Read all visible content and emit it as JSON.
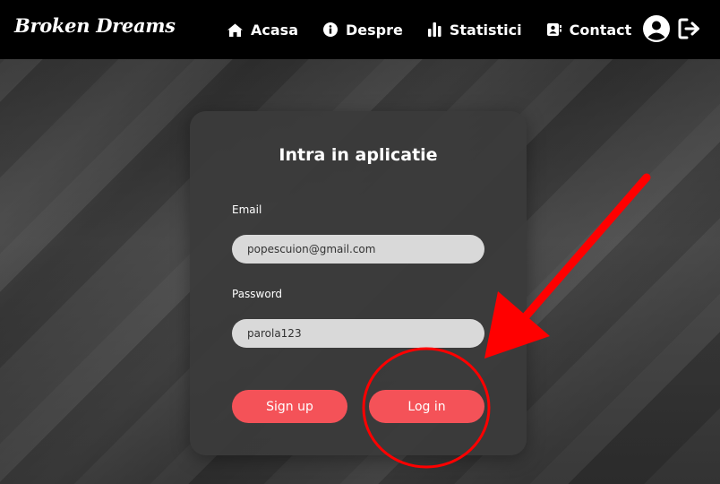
{
  "navbar": {
    "brand": "Broken Dreams",
    "links": [
      {
        "label": "Acasa",
        "icon": "home-icon"
      },
      {
        "label": "Despre",
        "icon": "info-icon"
      },
      {
        "label": "Statistici",
        "icon": "bar-chart-icon"
      },
      {
        "label": "Contact",
        "icon": "contact-card-icon"
      }
    ],
    "right_icons": [
      "user-circle-icon",
      "logout-icon"
    ]
  },
  "login": {
    "title": "Intra in aplicatie",
    "email_label": "Email",
    "email_value": "popescuion@gmail.com",
    "password_label": "Password",
    "password_value": "parola123",
    "signup_label": "Sign up",
    "login_label": "Log in"
  },
  "colors": {
    "navbar_bg": "#000000",
    "card_bg": "#3a3a3a",
    "input_bg": "#d9d9d9",
    "button_accent": "#f45258",
    "annotation": "#ff0000"
  },
  "annotation": {
    "shapes": [
      "red-arrow",
      "red-circle"
    ],
    "target": "login-button"
  }
}
